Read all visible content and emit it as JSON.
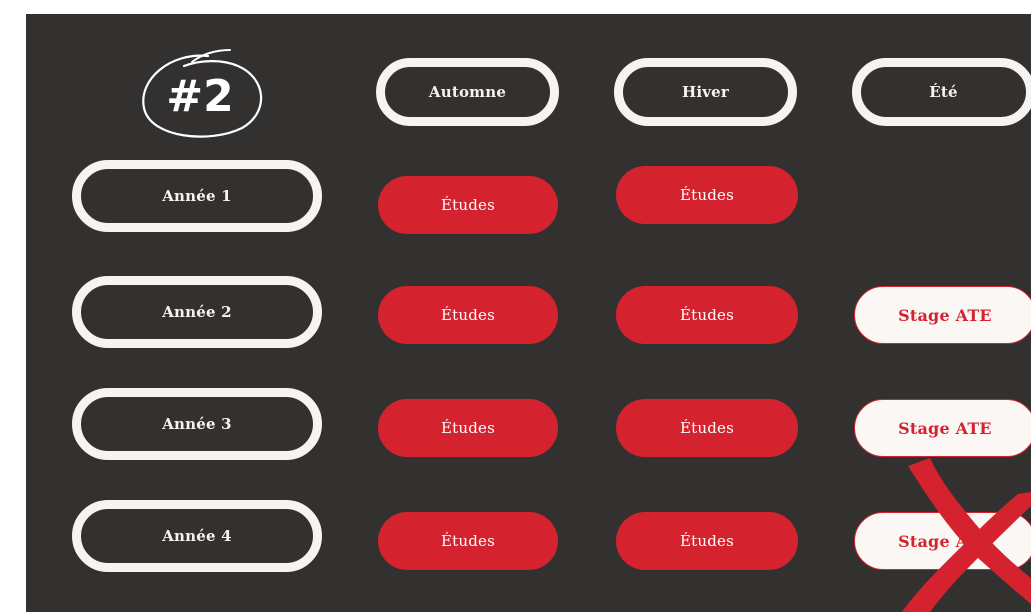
{
  "badge": {
    "label": "#2"
  },
  "seasons": [
    "Automne",
    "Hiver",
    "Été"
  ],
  "years": [
    {
      "label": "Année 1",
      "automne": "Études",
      "hiver": "Études",
      "ete": ""
    },
    {
      "label": "Année 2",
      "automne": "Études",
      "hiver": "Études",
      "ete": "Stage ATE"
    },
    {
      "label": "Année 3",
      "automne": "Études",
      "hiver": "Études",
      "ete": "Stage ATE"
    },
    {
      "label": "Année 4",
      "automne": "Études",
      "hiver": "Études",
      "ete": "Stage ATE",
      "ete_crossed_out": true
    }
  ],
  "colors": {
    "background": "#333030",
    "outline": "#f6f3f0",
    "study_fill": "#d4232e",
    "internship_fill": "#fbf7f4",
    "internship_text": "#d4232e",
    "cross": "#d4232e"
  }
}
